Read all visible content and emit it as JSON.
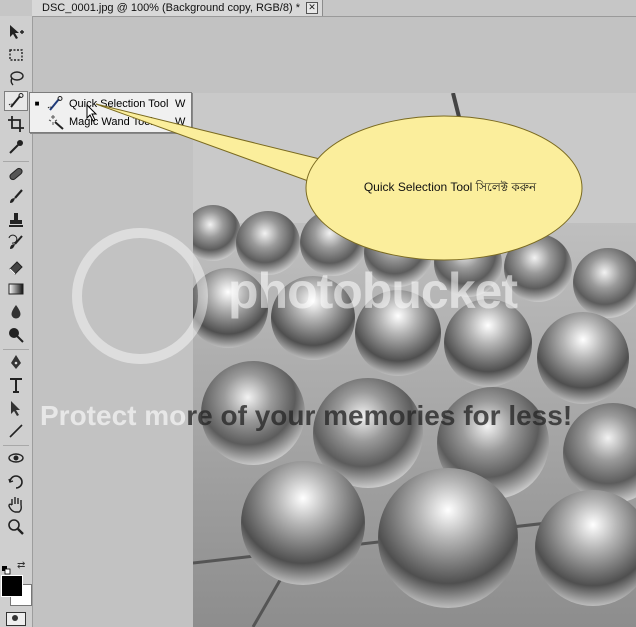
{
  "document_tab": {
    "title": "DSC_0001.jpg @ 100% (Background copy, RGB/8) *",
    "close_glyph": "✕"
  },
  "toolbar": {
    "tools": [
      {
        "name": "move-tool-icon"
      },
      {
        "name": "marquee-tool-icon"
      },
      {
        "name": "lasso-tool-icon"
      },
      {
        "name": "quick-selection-tool-icon"
      },
      {
        "name": "crop-tool-icon"
      },
      {
        "name": "eyedropper-tool-icon"
      },
      {
        "name": "spot-healing-brush-tool-icon"
      },
      {
        "name": "brush-tool-icon"
      },
      {
        "name": "clone-stamp-tool-icon"
      },
      {
        "name": "history-brush-tool-icon"
      },
      {
        "name": "eraser-tool-icon"
      },
      {
        "name": "gradient-tool-icon"
      },
      {
        "name": "blur-tool-icon"
      },
      {
        "name": "dodge-tool-icon"
      },
      {
        "name": "pen-tool-icon"
      },
      {
        "name": "type-tool-icon"
      },
      {
        "name": "path-selection-tool-icon"
      },
      {
        "name": "line-tool-icon"
      },
      {
        "name": "3d-rotate-tool-icon"
      },
      {
        "name": "3d-orbit-tool-icon"
      },
      {
        "name": "hand-tool-icon"
      },
      {
        "name": "zoom-tool-icon"
      }
    ],
    "foreground_color": "#000000",
    "background_color": "#ffffff"
  },
  "flyout": {
    "items": [
      {
        "label": "Quick Selection Tool",
        "shortcut": "W",
        "selected_marker": "■"
      },
      {
        "label": "Magic Wand Tool",
        "shortcut": "W"
      }
    ]
  },
  "callout": {
    "text": "Quick Selection Tool সিলেক্ট করুন",
    "fill": "#fbee9c"
  },
  "watermark": {
    "brand": "photobucket",
    "tagline_light": "Protect mo",
    "tagline_dark": "re of your memories for less!"
  }
}
